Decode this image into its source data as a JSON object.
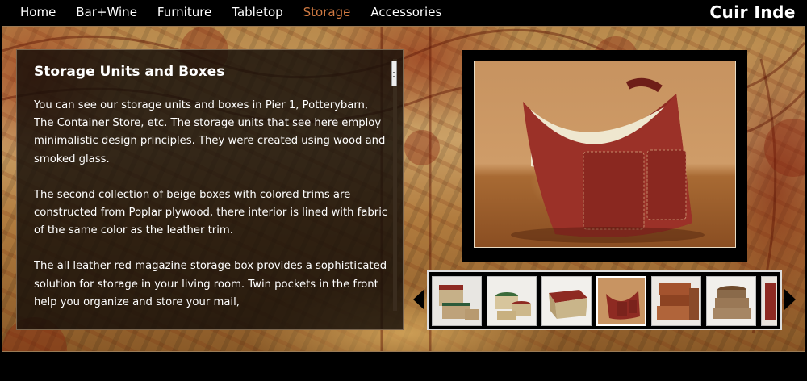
{
  "nav": {
    "items": [
      {
        "label": "Home",
        "active": false
      },
      {
        "label": "Bar+Wine",
        "active": false
      },
      {
        "label": "Furniture",
        "active": false
      },
      {
        "label": "Tabletop",
        "active": false
      },
      {
        "label": "Storage",
        "active": true
      },
      {
        "label": "Accessories",
        "active": false
      }
    ],
    "active_color": "#d07a42"
  },
  "brand": "Cuir Inde",
  "content": {
    "title": "Storage Units and Boxes",
    "paragraphs": [
      "You can see our storage units and boxes in Pier 1, Potterybarn, The Container Store, etc. The storage units that see here employ minimalistic design principles. They were created using wood and smoked glass.",
      "The second collection of beige boxes with colored trims are constructed from Poplar plywood, there interior is lined with fabric of the same color as the leather trim.",
      "The all leather red magazine storage box provides a sophisticated solution for storage in your living room. Twin pockets in the front help you organize and store your mail,"
    ]
  },
  "gallery": {
    "selected_index": 3,
    "thumbnails": [
      {
        "name": "beige-boxes-red-trim"
      },
      {
        "name": "round-boxes-green"
      },
      {
        "name": "beige-tray-red-trim"
      },
      {
        "name": "red-leather-magazine-box"
      },
      {
        "name": "brown-leather-chests"
      },
      {
        "name": "round-hat-boxes"
      },
      {
        "name": "partial-thumbnail"
      }
    ]
  },
  "colors": {
    "leather_red": "#8e2a22",
    "beige": "#c9b58a"
  }
}
